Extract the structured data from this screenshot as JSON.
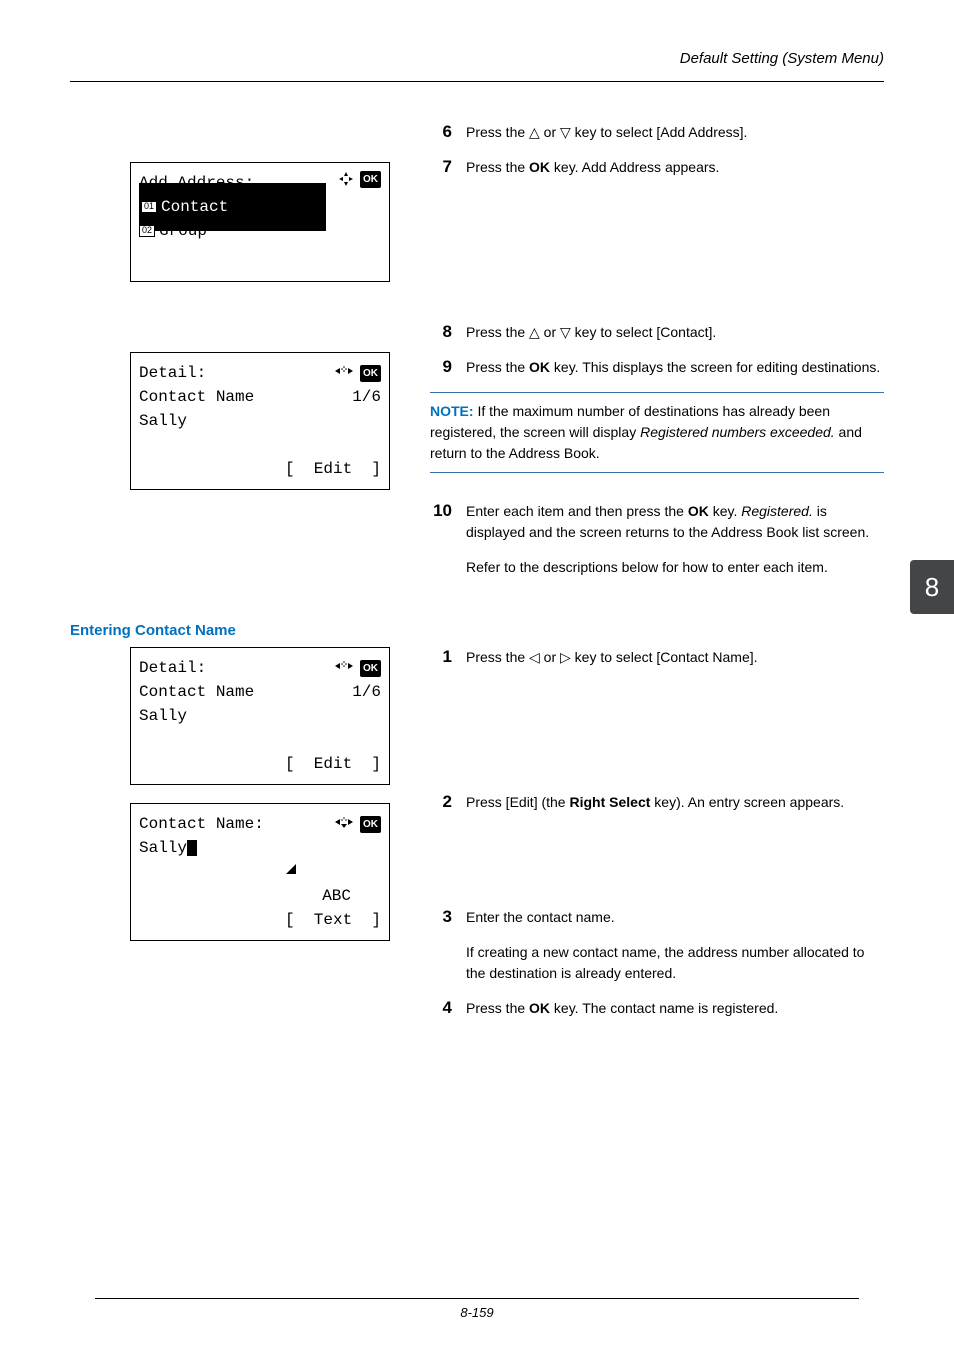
{
  "header": {
    "title": "Default Setting (System Menu)"
  },
  "tab": {
    "number": "8"
  },
  "footer": {
    "page": "8-159"
  },
  "lcd1": {
    "title": "Add Address:",
    "item1_num": "01",
    "item1_label": "Contact",
    "item2_num": "02",
    "item2_label": "Group",
    "ok": "OK"
  },
  "lcd2": {
    "title": "Detail:",
    "line2a": "Contact Name",
    "line2b": "1/6",
    "line3": "Sally",
    "button": "[  Edit  ]",
    "ok": "OK"
  },
  "lcd3": {
    "title": "Detail:",
    "line2a": "Contact Name",
    "line2b": "1/6",
    "line3": "Sally",
    "button": "[  Edit  ]",
    "ok": "OK"
  },
  "lcd4": {
    "title": "Contact Name:",
    "line2": "Sally",
    "mode": "ABC",
    "button": "[  Text  ]",
    "ok": "OK"
  },
  "steps": {
    "s6": "Press the △ or ▽ key to select [Add Address].",
    "s7_a": "Press the ",
    "s7_b": "OK",
    "s7_c": " key. Add Address appears.",
    "s8": "Press the △ or ▽ key to select [Contact].",
    "s9_a": "Press the ",
    "s9_b": "OK",
    "s9_c": " key. This displays the screen for editing destinations.",
    "s10_a": "Enter each item and then press the ",
    "s10_b": "OK",
    "s10_c": " key. ",
    "s10_d": "Registered.",
    "s10_e": " is displayed and the screen returns to the Address Book list screen.",
    "s10_f": "Refer to the descriptions below for how to enter each item.",
    "s1b": "Press the ◁ or ▷ key to select [Contact Name].",
    "s2b_a": "Press [Edit] (the ",
    "s2b_b": "Right Select",
    "s2b_c": " key). An entry screen appears.",
    "s3b_a": "Enter the contact name.",
    "s3b_b": "If creating a new contact name, the address number allocated to the destination is already entered.",
    "s4b_a": "Press the ",
    "s4b_b": "OK",
    "s4b_c": " key. The contact name is registered."
  },
  "note": {
    "label": "NOTE:",
    "text_a": " If the maximum number of destinations has already been registered, the screen will display ",
    "text_b": "Registered numbers exceeded.",
    "text_c": " and return to the Address Book."
  },
  "subheading": "Entering Contact Name"
}
